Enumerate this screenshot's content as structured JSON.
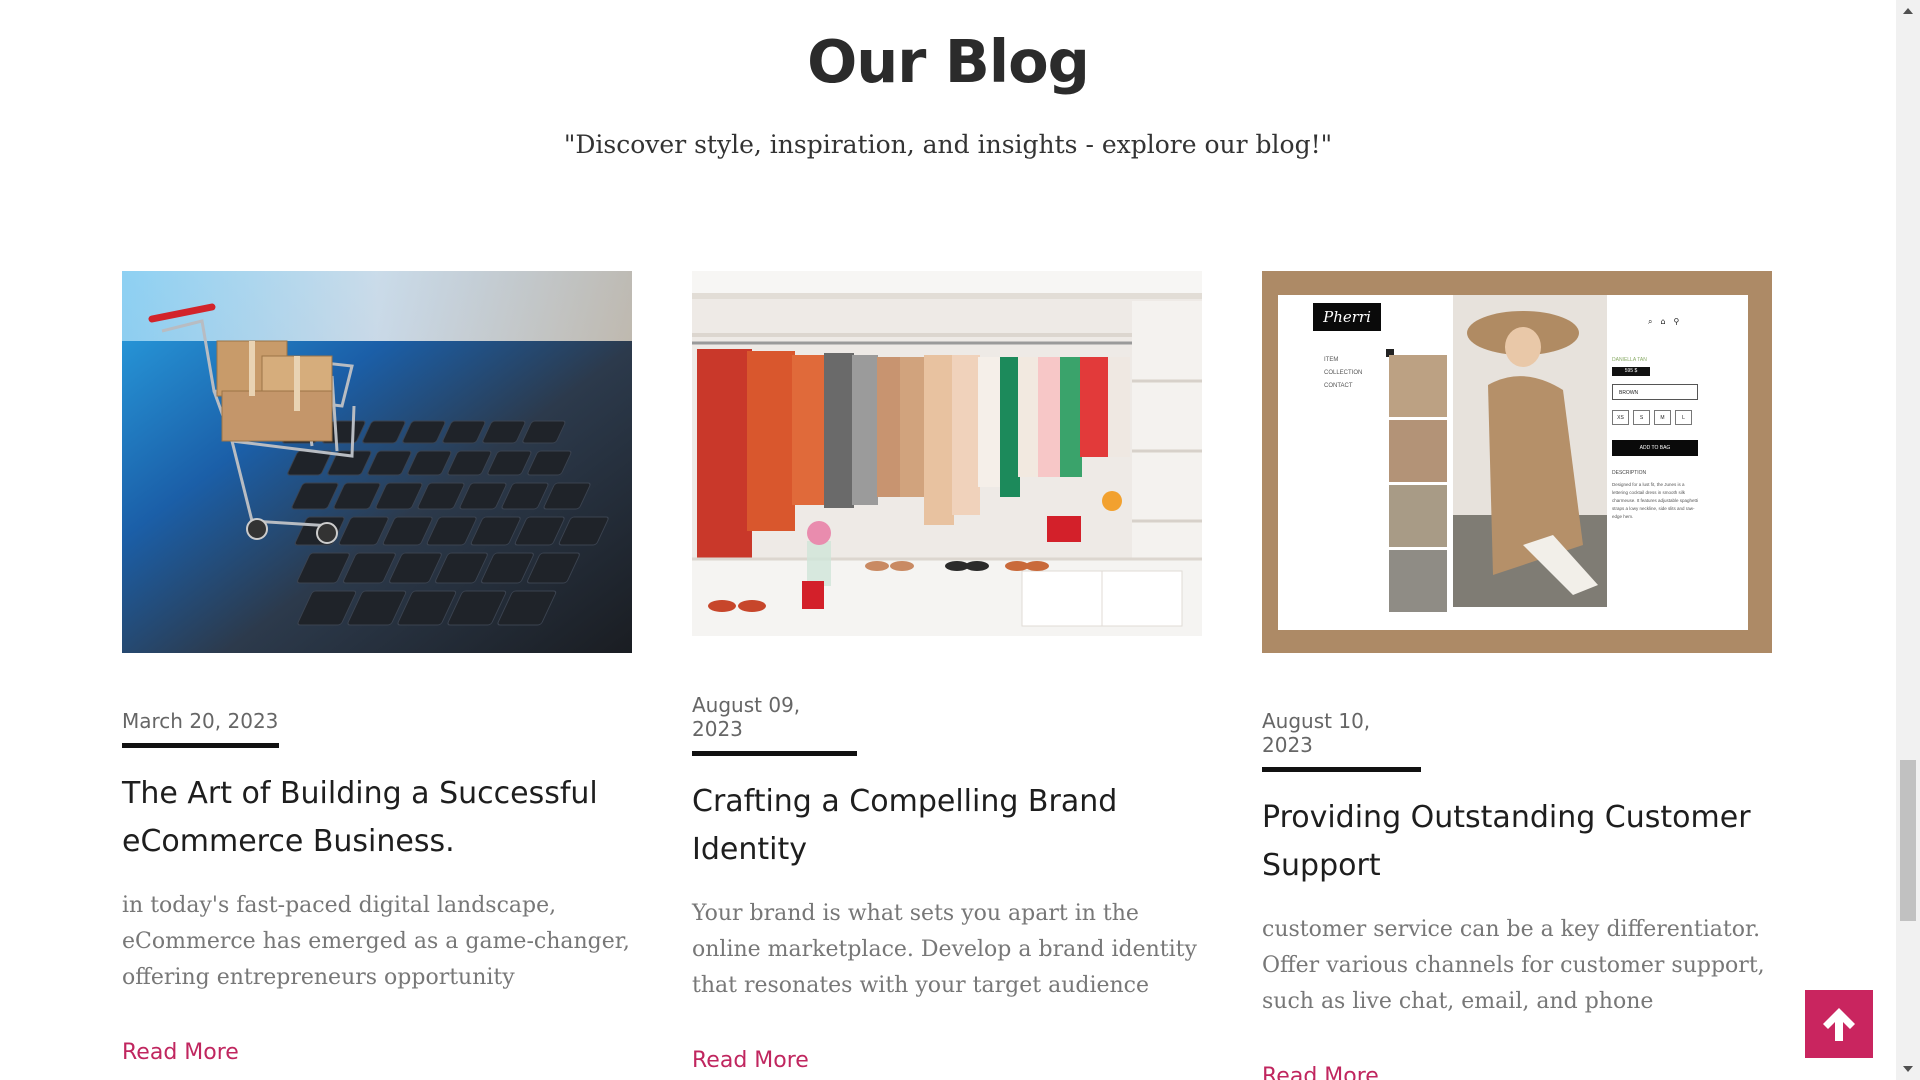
{
  "header": {
    "title": "Our Blog",
    "subtitle": "\"Discover style, inspiration, and insights - explore our blog!\""
  },
  "posts": [
    {
      "date": "March 20, 2023",
      "title": "The Art of Building a Successful eCommerce Business.",
      "excerpt": "in today's fast-paced digital landscape, eCommerce has emerged as a game-changer, offering entrepreneurs opportunity",
      "read_more": "Read More",
      "image": "shopping-cart-on-laptop-keyboard"
    },
    {
      "date": "August 09, 2023",
      "title": "Crafting a Compelling Brand Identity",
      "excerpt": "Your brand is what sets you apart in the online marketplace. Develop a brand identity that resonates with your target audience",
      "read_more": "Read More",
      "image": "clothing-rack-boutique"
    },
    {
      "date": "August 10, 2023",
      "title": "Providing Outstanding Customer Support",
      "excerpt": "customer service can be a key differentiator. Offer various channels for customer support, such as live chat, email, and phone",
      "read_more": "Read More",
      "image": "fashion-store-webpage-mockup"
    }
  ],
  "mockup": {
    "brand": "Pherri",
    "nav": [
      "ITEM",
      "COLLECTION",
      "CONTACT"
    ],
    "product_name": "DANIELLA TAN",
    "price": "595 $",
    "color": "BROWN",
    "sizes": [
      "XS",
      "S",
      "M",
      "L"
    ],
    "cta": "ADD TO BAG",
    "description_label": "DESCRIPTION",
    "description": "Designed for a lust fit, the Junes is a lettering cocktail dress in smooth silk charmeuse. It features adjustable spaghetti straps a lowy neckline, side slits and raw-edge hem."
  },
  "colors": {
    "accent": "#c9255f",
    "read_more": "#c0265f",
    "mockup_frame": "#ad8a66"
  },
  "icons": {
    "scroll_top": "arrow-up-icon"
  }
}
